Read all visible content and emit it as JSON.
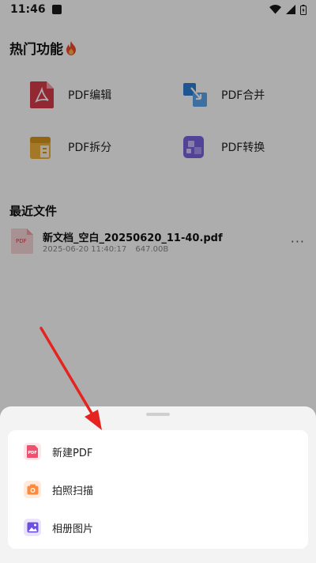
{
  "status_bar": {
    "time": "11:46"
  },
  "hot_features": {
    "title": "热门功能",
    "items": [
      {
        "label": "PDF编辑",
        "icon": "pdf-edit-icon",
        "color": "#d63b4a"
      },
      {
        "label": "PDF合并",
        "icon": "pdf-merge-icon",
        "color": "#2f7fd6"
      },
      {
        "label": "PDF拆分",
        "icon": "pdf-split-icon",
        "color": "#f0b23a"
      },
      {
        "label": "PDF转换",
        "icon": "pdf-convert-icon",
        "color": "#7b63e0"
      }
    ]
  },
  "recent_files": {
    "title": "最近文件",
    "items": [
      {
        "name": "新文档_空白_20250620_11-40.pdf",
        "date": "2025-06-20 11:40:17",
        "size": "647.00B",
        "thumb_label": "PDF"
      }
    ]
  },
  "sheet": {
    "items": [
      {
        "label": "新建PDF",
        "icon": "new-pdf-icon",
        "color": "#f0506e",
        "icon_text": "PDF"
      },
      {
        "label": "拍照扫描",
        "icon": "camera-scan-icon",
        "color": "#ff8a3d"
      },
      {
        "label": "相册图片",
        "icon": "album-image-icon",
        "color": "#6a4fe0"
      }
    ]
  },
  "colors": {
    "scrim": "rgba(0,0,0,0.32)",
    "arrow": "#e52420",
    "sheet_bg": "#f3f3f3"
  }
}
